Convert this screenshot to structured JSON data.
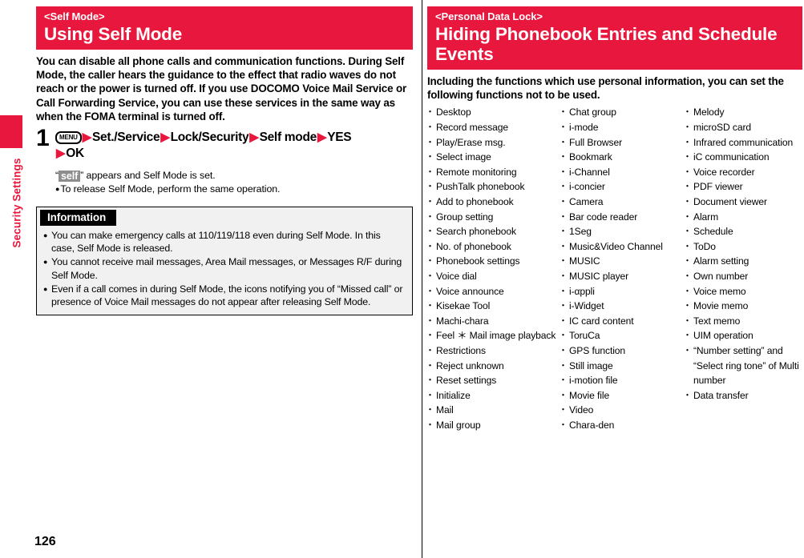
{
  "sidebar": {
    "chapter_label": "Security Settings",
    "accent_color": "#e8173d"
  },
  "page_number": "126",
  "left_column": {
    "section": {
      "kicker": "<Self Mode>",
      "title": "Using Self Mode"
    },
    "intro": "You can disable all phone calls and communication functions. During Self Mode, the caller hears the guidance to the effect that radio waves do not reach or the power is turned off. If you use DOCOMO Voice Mail Service or Call Forwarding Service, you can use these services in the same way as when the FOMA terminal is turned off.",
    "step": {
      "number": "1",
      "key_label": "MENU",
      "sequence": [
        "Set./Service",
        "Lock/Security",
        "Self mode",
        "YES",
        "OK"
      ],
      "note_prefix": "“",
      "note_icon": "self",
      "note_suffix": "” appears and Self Mode is set.",
      "note_bullet": "To release Self Mode, perform the same operation."
    },
    "information": {
      "title": "Information",
      "items": [
        "You can make emergency calls at 110/119/118 even during Self Mode. In this case, Self Mode is released.",
        "You cannot receive mail messages, Area Mail messages, or Messages R/F during Self Mode.",
        "Even if a call comes in during Self Mode, the icons notifying you of “Missed call” or presence of Voice Mail messages do not appear after releasing Self Mode."
      ]
    }
  },
  "right_column": {
    "section": {
      "kicker": "<Personal Data Lock>",
      "title": "Hiding Phonebook Entries and Schedule Events"
    },
    "intro": "Including the functions which use personal information, you can set the following functions not to be used.",
    "function_columns": [
      [
        "Desktop",
        "Record message",
        "Play/Erase msg.",
        "Select image",
        "Remote monitoring",
        "PushTalk phonebook",
        "Add to phonebook",
        "Group setting",
        "Search phonebook",
        "No. of phonebook",
        "Phonebook settings",
        "Voice dial",
        "Voice announce",
        "Kisekae Tool",
        "Machi-chara",
        "Feel ＊ Mail image playback",
        "Restrictions",
        "Reject unknown",
        "Reset settings",
        "Initialize",
        "Mail",
        "Mail group"
      ],
      [
        "Chat group",
        "i-mode",
        "Full Browser",
        "Bookmark",
        "i-Channel",
        "i-concier",
        "Camera",
        "Bar code reader",
        "1Seg",
        "Music&Video Channel",
        "MUSIC",
        "MUSIC player",
        "i-αppli",
        "i-Widget",
        "IC card content",
        "ToruCa",
        "GPS function",
        "Still image",
        "i-motion file",
        "Movie file",
        "Video",
        "Chara-den"
      ],
      [
        "Melody",
        "microSD card",
        "Infrared communication",
        "iC communication",
        "Voice recorder",
        "PDF viewer",
        "Document viewer",
        "Alarm",
        "Schedule",
        "ToDo",
        "Alarm setting",
        "Own number",
        "Voice memo",
        "Movie memo",
        "Text memo",
        "UIM operation",
        "“Number setting” and “Select ring tone” of Multi number",
        "Data transfer"
      ]
    ],
    "multiline_item_index": 16,
    "multiline_item_lines": [
      "“Number setting” and",
      "“Select ring tone” of Multi",
      "number"
    ]
  }
}
